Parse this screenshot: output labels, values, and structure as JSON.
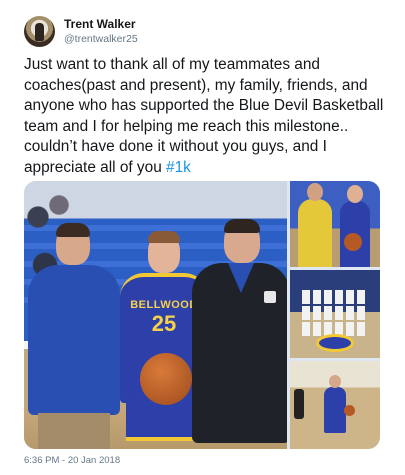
{
  "user": {
    "display_name": "Trent Walker",
    "handle": "@trentwalker25"
  },
  "tweet": {
    "text_before_hashtag": "Just want to thank all of my teammates and coaches(past and present), my family, friends, and anyone who has supported the Blue Devil Basketball team and I for helping me reach this milestone.. couldn’t have done it without you guys, and I appreciate all of you ",
    "hashtag": "#1k",
    "timestamp": "6:36 PM - 20 Jan 2018"
  },
  "media": {
    "main_photo": {
      "jersey_text": "BELLWOOD",
      "jersey_number": "25"
    }
  },
  "colors": {
    "hashtag": "#1b95e0",
    "handle": "#657786",
    "team_blue": "#2d3fa8",
    "team_gold": "#f2c935"
  },
  "icons": {
    "avatar": "profile-avatar"
  }
}
